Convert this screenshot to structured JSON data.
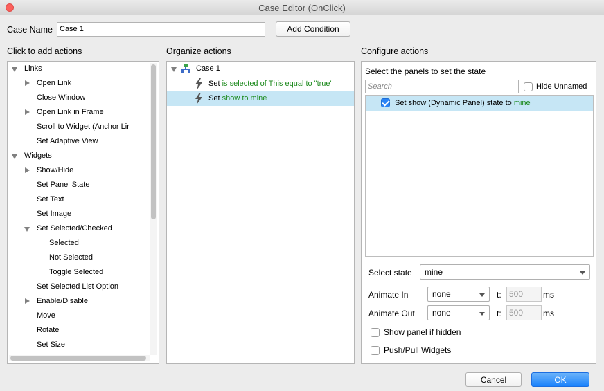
{
  "window": {
    "title": "Case Editor (OnClick)"
  },
  "case_name": {
    "label": "Case Name",
    "value": "Case 1",
    "add_condition": "Add Condition"
  },
  "left": {
    "title": "Click to add actions",
    "items": [
      "Links",
      "Open Link",
      "Close Window",
      "Open Link in Frame",
      "Scroll to Widget (Anchor Lir",
      "Set Adaptive View",
      "Widgets",
      "Show/Hide",
      "Set Panel State",
      "Set Text",
      "Set Image",
      "Set Selected/Checked",
      "Selected",
      "Not Selected",
      "Toggle Selected",
      "Set Selected List Option",
      "Enable/Disable",
      "Move",
      "Rotate",
      "Set Size"
    ]
  },
  "middle": {
    "title": "Organize actions",
    "case_label": "Case 1",
    "actions": [
      {
        "prefix": "Set",
        "detail": "is selected of This equal to \"true\""
      },
      {
        "prefix": "Set",
        "detail": "show to mine"
      }
    ]
  },
  "right": {
    "title": "Configure actions",
    "subtitle": "Select the panels to set the state",
    "search_placeholder": "Search",
    "hide_unnamed": "Hide Unnamed",
    "panel_row": {
      "text": "Set show (Dynamic Panel) state to",
      "state": "mine"
    },
    "select_state_label": "Select state",
    "select_state_value": "mine",
    "animate_in_label": "Animate In",
    "animate_in_value": "none",
    "animate_out_label": "Animate Out",
    "animate_out_value": "none",
    "t_label": "t:",
    "t_in_value": "500",
    "t_out_value": "500",
    "ms": "ms",
    "show_if_hidden": "Show panel if hidden",
    "push_pull": "Push/Pull Widgets"
  },
  "footer": {
    "cancel": "Cancel",
    "ok": "OK"
  },
  "colors": {
    "accent": "#1a82fb",
    "green_text": "#1d8a1d",
    "selection": "#c6e6f5"
  }
}
